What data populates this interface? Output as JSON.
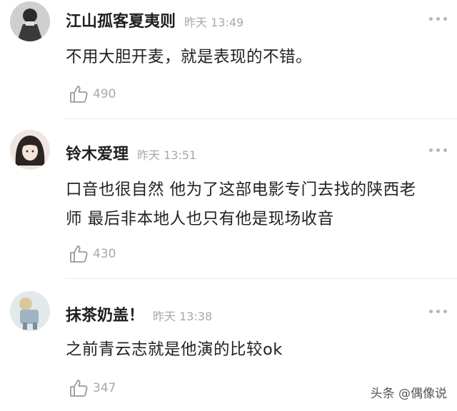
{
  "comments": [
    {
      "username": "江山孤客夏夷则",
      "time": "昨天 13:49",
      "text": "不用大胆开麦，就是表现的不错。",
      "likes": "490"
    },
    {
      "username": "铃木爱理",
      "time": "昨天 13:51",
      "text": "口音也很自然 他为了这部电影专门去找的陕西老师 最后非本地人也只有他是现场收音",
      "likes": "430"
    },
    {
      "username": "抹茶奶盖！",
      "time": "昨天 13:38",
      "text": "之前青云志就是他演的比较ok",
      "likes": "347"
    }
  ],
  "watermark": "头条 @偶像说"
}
